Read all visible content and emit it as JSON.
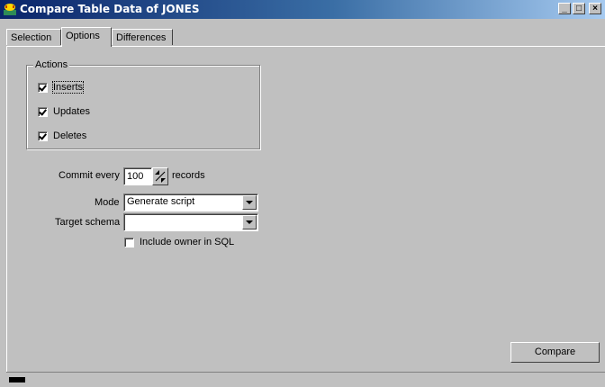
{
  "window": {
    "title": "Compare Table Data of JONES",
    "min_glyph": "_",
    "max_glyph": "□",
    "close_glyph": "×",
    "title_gradient": [
      "#0a246a",
      "#a6caf0"
    ]
  },
  "tabs": [
    {
      "label": "Selection",
      "active": false
    },
    {
      "label": "Options",
      "active": true
    },
    {
      "label": "Differences",
      "active": false
    }
  ],
  "actions": {
    "group_label": "Actions",
    "items": [
      {
        "label": "Inserts",
        "checked": true,
        "focused": true
      },
      {
        "label": "Updates",
        "checked": true
      },
      {
        "label": "Deletes",
        "checked": true
      }
    ]
  },
  "commit": {
    "label": "Commit every",
    "value": "100",
    "suffix": "records"
  },
  "mode": {
    "label": "Mode",
    "value": "Generate script"
  },
  "target_schema": {
    "label": "Target schema",
    "value": ""
  },
  "include_owner": {
    "label": "Include owner in SQL",
    "checked": false
  },
  "compare_button": {
    "label": "Compare"
  }
}
